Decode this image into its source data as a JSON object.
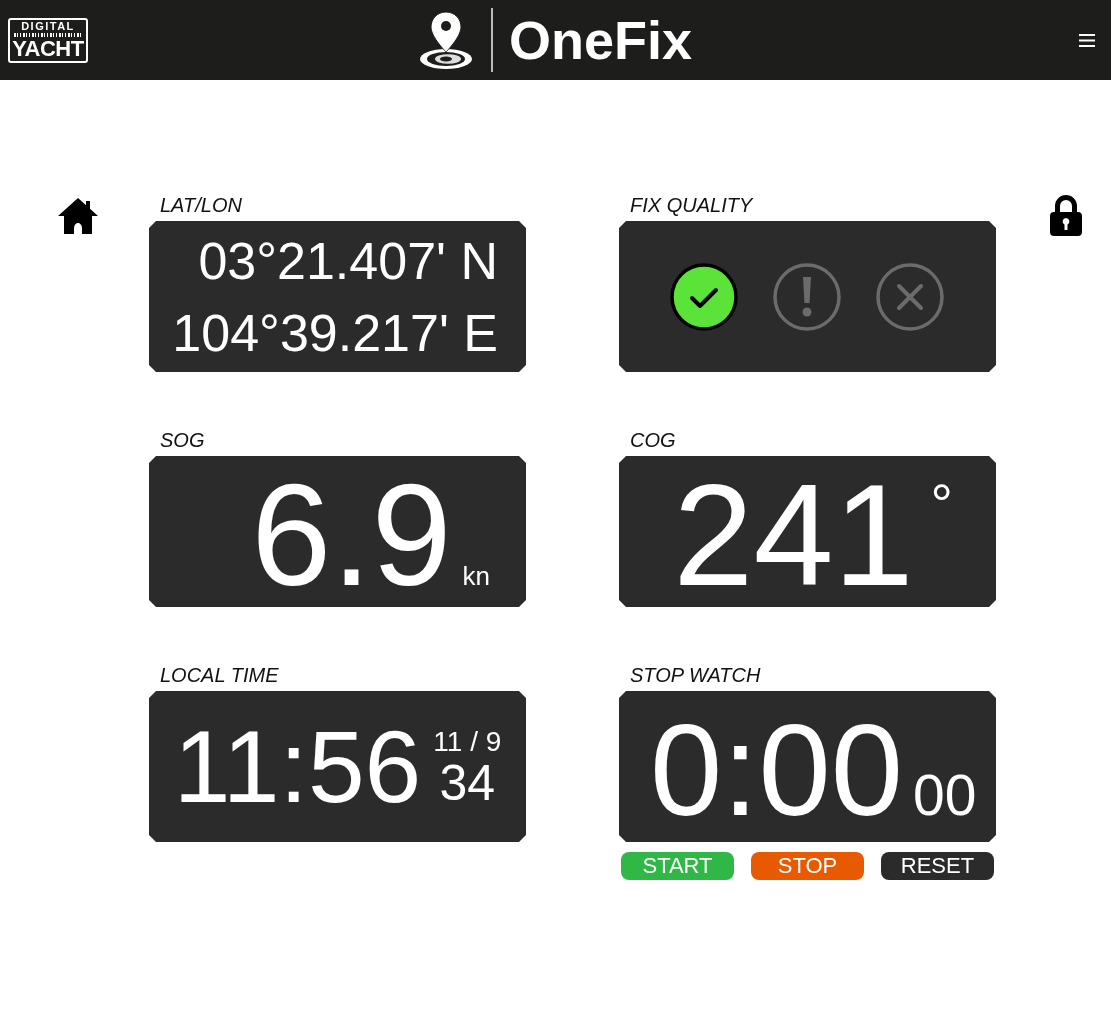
{
  "header": {
    "brand_logo": {
      "line_1": "DIGITAL",
      "line_2": "YACHT"
    },
    "app_title": "OneFix"
  },
  "panels": [
    {
      "kind": "position",
      "label": "LAT/LON",
      "lat": "03°21.407' N",
      "lon": "104°39.217' E"
    },
    {
      "kind": "fix_quality",
      "label": "FIX QUALITY",
      "indicators": [
        {
          "kind": "ok",
          "on": true
        },
        {
          "kind": "warning",
          "on": false
        },
        {
          "kind": "error",
          "on": false
        }
      ]
    },
    {
      "kind": "speed",
      "label": "SOG",
      "value": "6.9",
      "unit": "kn"
    },
    {
      "kind": "course",
      "label": "COG",
      "value": "241",
      "unit": "°"
    },
    {
      "kind": "clock",
      "label": "LOCAL TIME",
      "time": "11:56",
      "date": "11 / 9",
      "seconds": "34"
    },
    {
      "kind": "stopwatch",
      "label": "STOP WATCH",
      "time": "0:00",
      "hundredths": "00",
      "buttons": [
        {
          "label": "START",
          "color": "#2fb845"
        },
        {
          "label": "STOP",
          "color": "#e85a00"
        },
        {
          "label": "RESET",
          "color": "#2b2b2b"
        }
      ]
    }
  ]
}
